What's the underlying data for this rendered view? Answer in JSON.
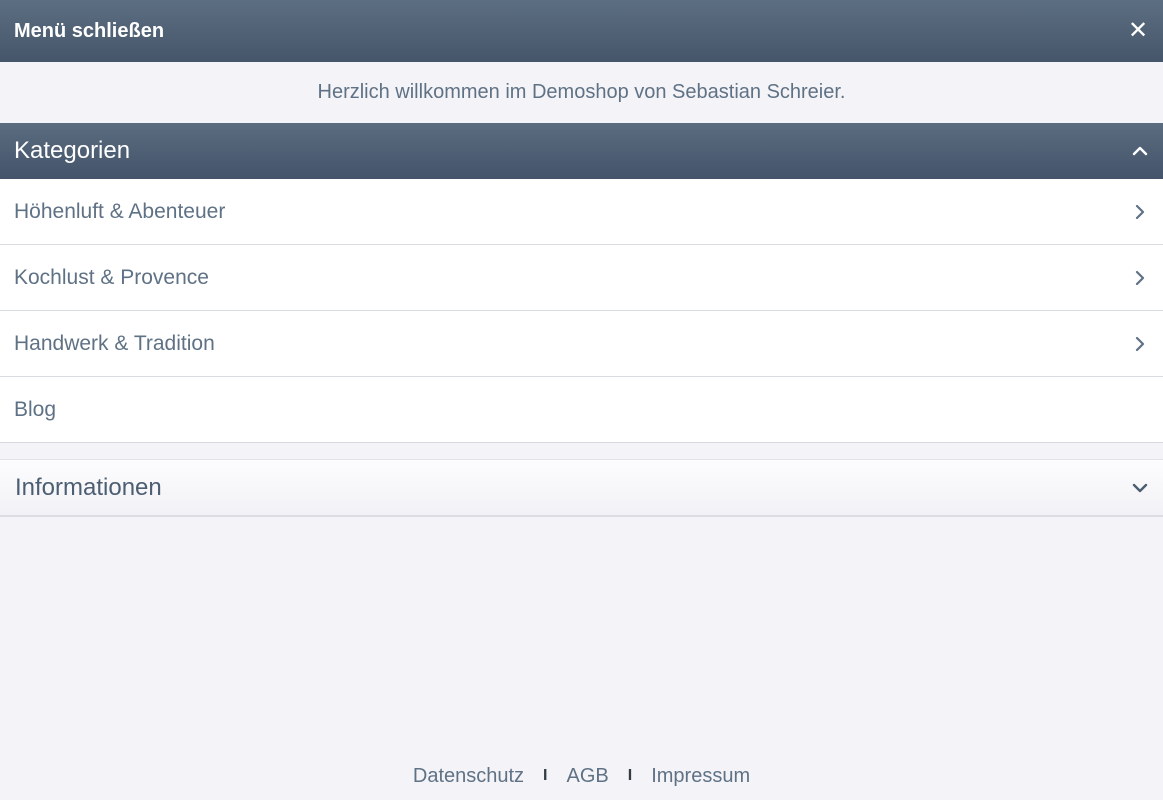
{
  "topbar": {
    "title": "Menü schließen",
    "close_icon": "close-icon"
  },
  "welcome": "Herzlich willkommen im Demoshop von Sebastian Schreier.",
  "categories": {
    "header": "Kategorien",
    "items": [
      {
        "label": "Höhenluft & Abenteuer",
        "has_children": true
      },
      {
        "label": "Kochlust & Provence",
        "has_children": true
      },
      {
        "label": "Handwerk & Tradition",
        "has_children": true
      },
      {
        "label": "Blog",
        "has_children": false
      }
    ]
  },
  "info": {
    "header": "Informationen"
  },
  "footer": {
    "links": [
      "Datenschutz",
      "AGB",
      "Impressum"
    ],
    "separator": "I"
  },
  "colors": {
    "header_bg": "#4f6075",
    "text": "#5f7285",
    "background": "#f4f3f7"
  }
}
